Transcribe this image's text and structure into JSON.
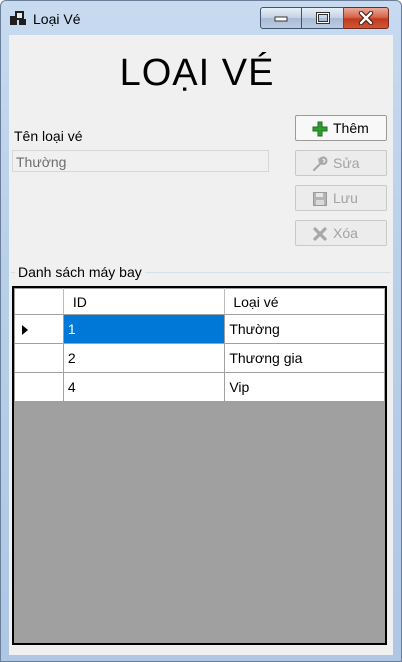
{
  "window": {
    "title": "Loại Vé"
  },
  "form": {
    "heading": "LOẠI VÉ",
    "ticket_type_label": "Tên loại vé",
    "ticket_type_value": "Thường"
  },
  "buttons": {
    "add": "Thêm",
    "edit": "Sửa",
    "save": "Lưu",
    "delete": "Xóa"
  },
  "list": {
    "group_title": "Danh sách máy bay",
    "columns": [
      "ID",
      "Loại vé"
    ],
    "rows": [
      {
        "id": "1",
        "type": "Thường"
      },
      {
        "id": "2",
        "type": "Thương gia"
      },
      {
        "id": "4",
        "type": "Vip"
      }
    ],
    "selected_index": 0
  },
  "colors": {
    "selection": "#0078d7",
    "grid_background": "#a0a0a0",
    "add_icon": "#2e9e2e"
  },
  "icons": [
    "app-icon",
    "minimize-icon",
    "maximize-icon",
    "close-icon",
    "plus-icon",
    "wrench-icon",
    "floppy-disk-icon",
    "x-icon",
    "row-pointer-icon"
  ]
}
